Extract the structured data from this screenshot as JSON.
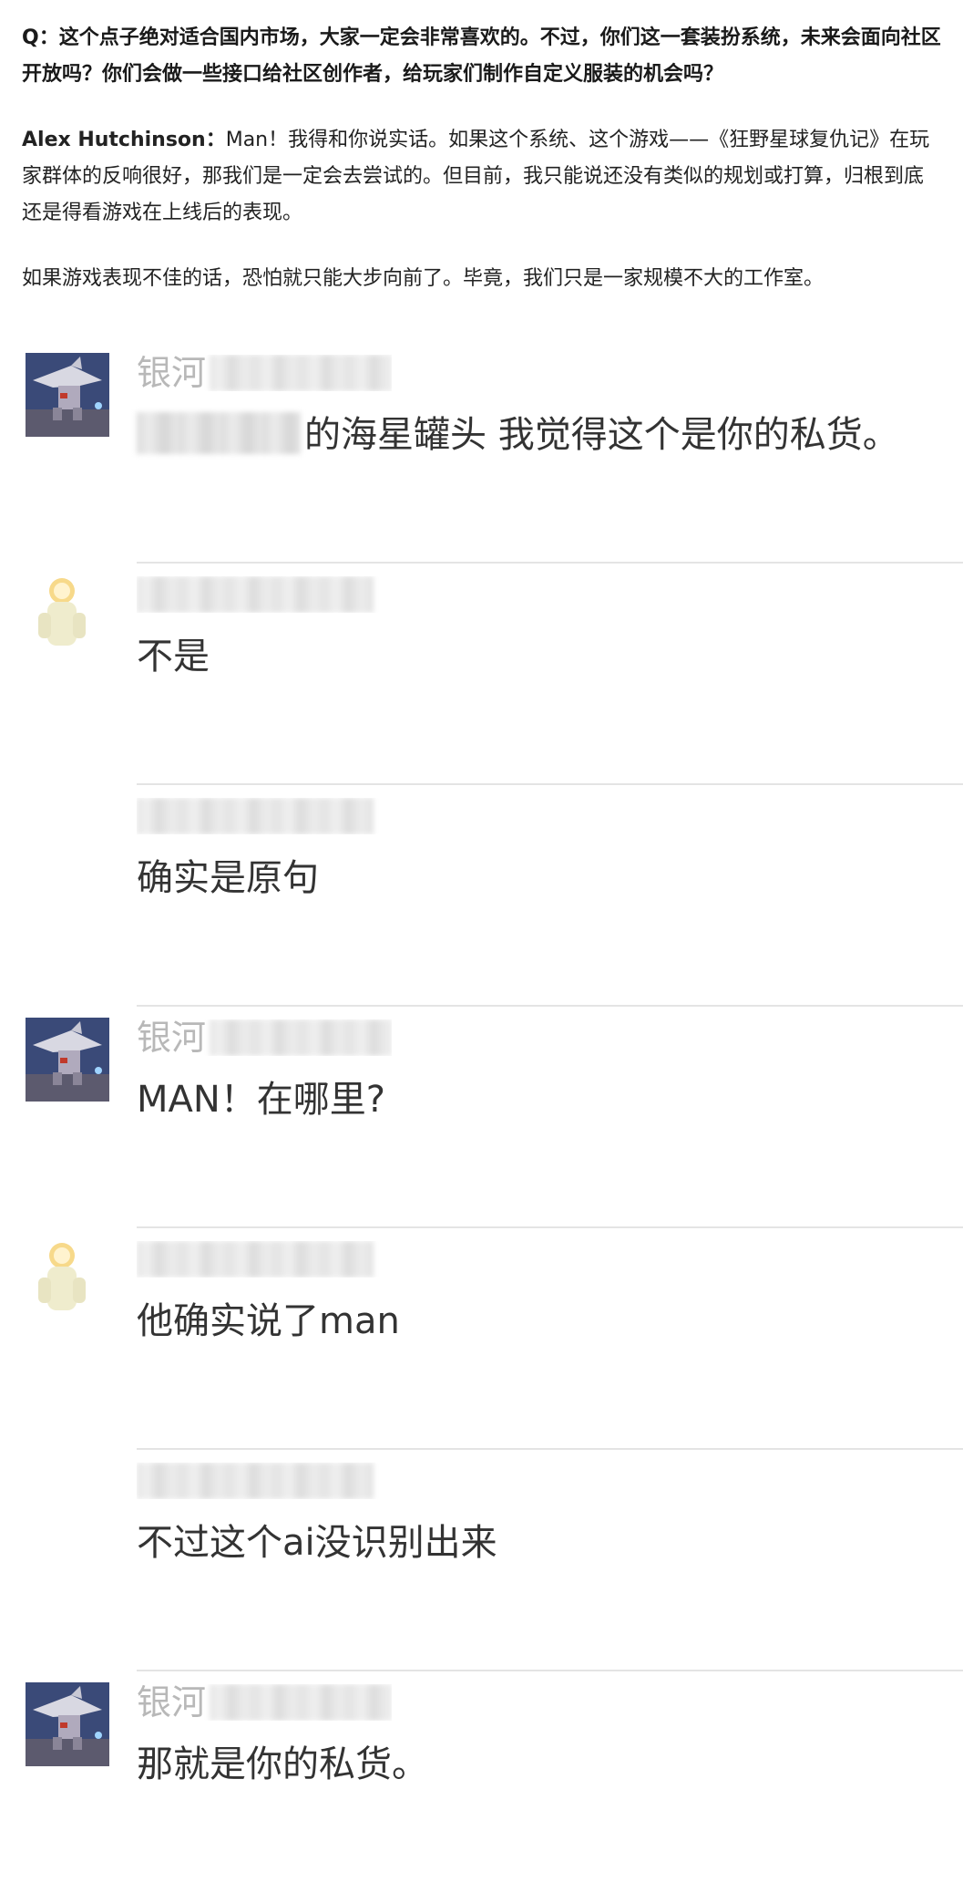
{
  "article": {
    "question": "Q：这个点子绝对适合国内市场，大家一定会非常喜欢的。不过，你们这一套装扮系统，未来会面向社区开放吗？你们会做一些接口给社区创作者，给玩家们制作自定义服装的机会吗？",
    "answer_speaker": "Alex Hutchinson：",
    "answer_text": "Man！我得和你说实话。如果这个系统、这个游戏——《狂野星球复仇记》在玩家群体的反响很好，那我们是一定会去尝试的。但目前，我只能说还没有类似的规划或打算，归根到底还是得看游戏在上线后的表现。",
    "closing": "如果游戏表现不佳的话，恐怕就只能大步向前了。毕竟，我们只是一家规模不大的工作室。"
  },
  "comments": [
    {
      "avatar": "shark-robot-avatar",
      "name_visible": "银河",
      "message": "的海星罐头 我觉得这个是你的私货。"
    },
    {
      "avatar": "glowing-figure-avatar",
      "name_visible": "",
      "message": "不是"
    },
    {
      "avatar": "",
      "name_visible": "",
      "message": "确实是原句"
    },
    {
      "avatar": "shark-robot-avatar",
      "name_visible": "银河",
      "message": "MAN！在哪里?"
    },
    {
      "avatar": "glowing-figure-avatar",
      "name_visible": "",
      "message": "他确实说了man"
    },
    {
      "avatar": "",
      "name_visible": "",
      "message": "不过这个ai没识别出来"
    },
    {
      "avatar": "shark-robot-avatar",
      "name_visible": "银河",
      "message": "那就是你的私货。"
    }
  ]
}
